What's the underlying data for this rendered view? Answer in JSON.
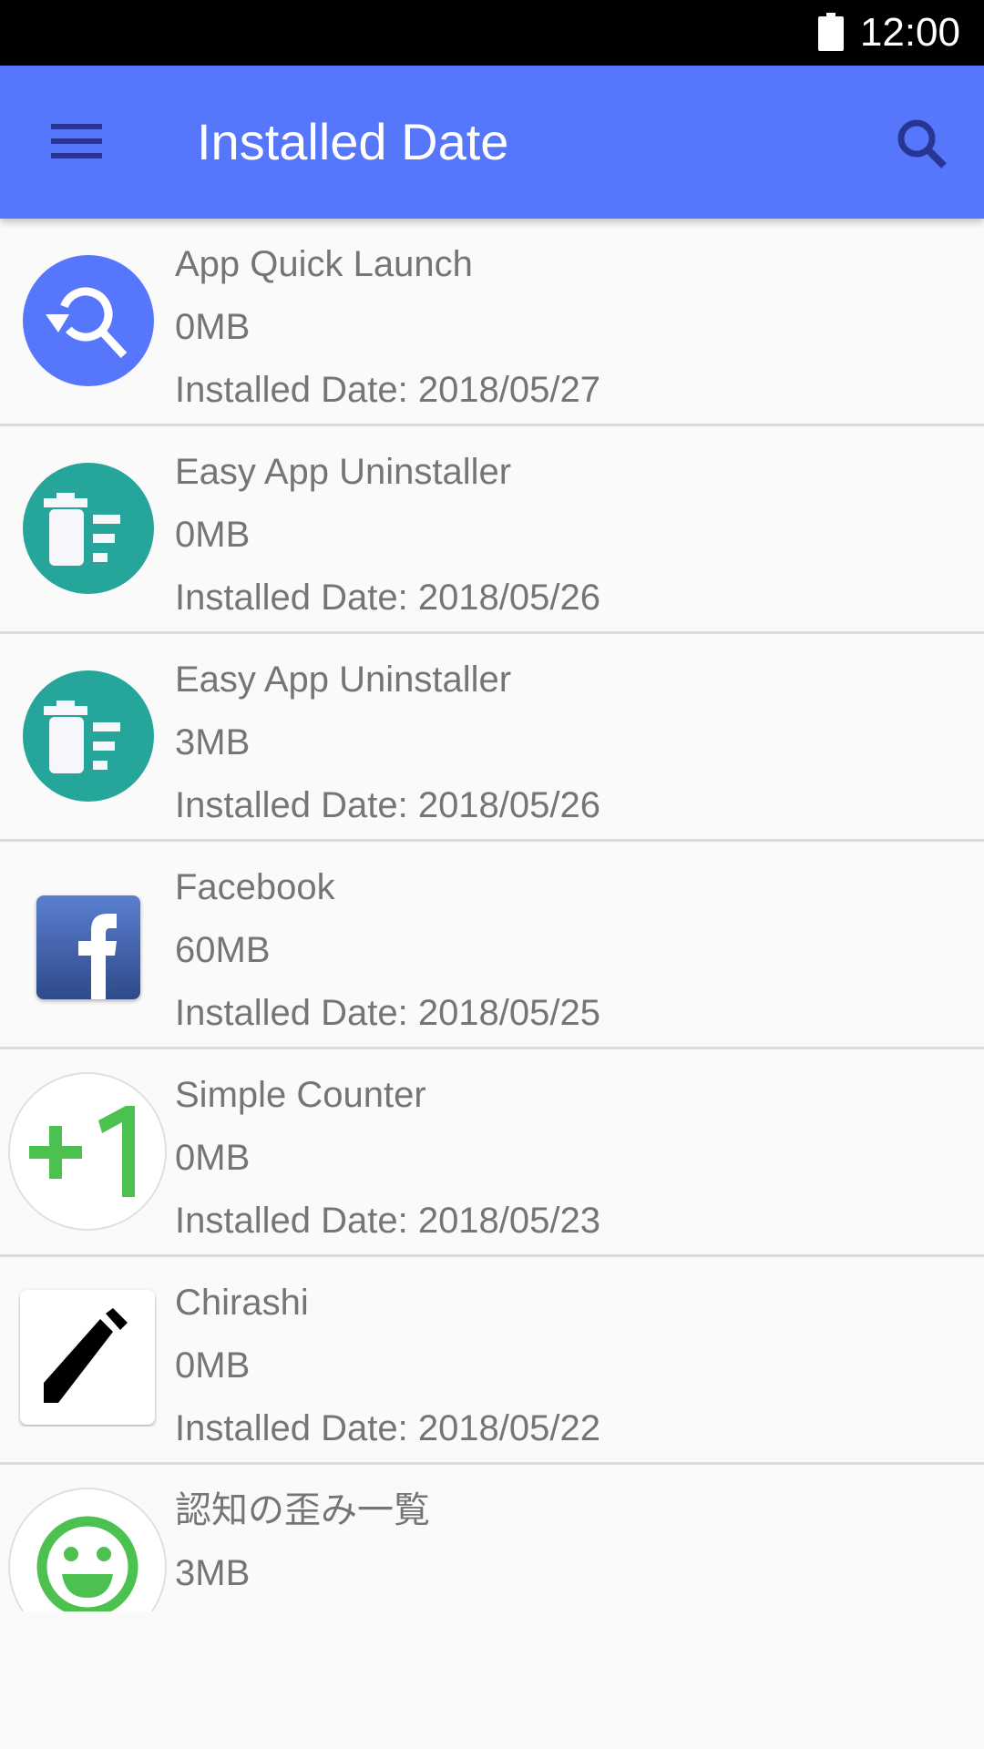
{
  "status_bar": {
    "time": "12:00",
    "battery_icon": "battery-full-icon"
  },
  "app_bar": {
    "title": "Installed Date",
    "menu_icon": "hamburger-menu-icon",
    "search_icon": "search-icon",
    "color": "#5677fc",
    "icon_color": "#283593"
  },
  "apps": [
    {
      "name": "App Quick Launch",
      "size": "0MB",
      "installed": "Installed Date: 2018/05/27",
      "icon": "app-quick-launch-icon"
    },
    {
      "name": "Easy App Uninstaller",
      "size": "0MB",
      "installed": "Installed Date: 2018/05/26",
      "icon": "easy-app-uninstaller-icon"
    },
    {
      "name": "Easy App Uninstaller",
      "size": "3MB",
      "installed": "Installed Date: 2018/05/26",
      "icon": "easy-app-uninstaller-icon"
    },
    {
      "name": "Facebook",
      "size": "60MB",
      "installed": "Installed Date: 2018/05/25",
      "icon": "facebook-icon"
    },
    {
      "name": "Simple Counter",
      "size": "0MB",
      "installed": "Installed Date: 2018/05/23",
      "icon": "simple-counter-icon"
    },
    {
      "name": "Chirashi",
      "size": "0MB",
      "installed": "Installed Date: 2018/05/22",
      "icon": "pencil-icon"
    },
    {
      "name": "認知の歪み一覧",
      "size": "3MB",
      "installed": "",
      "icon": "smiley-face-icon"
    }
  ],
  "colors": {
    "quick_launch_blue": "#5677fc",
    "uninstaller_teal": "#26a69a",
    "facebook_blue": "#3b5998",
    "counter_green": "#4cc150",
    "text_gray": "#757575",
    "divider": "#dcdcdc"
  }
}
